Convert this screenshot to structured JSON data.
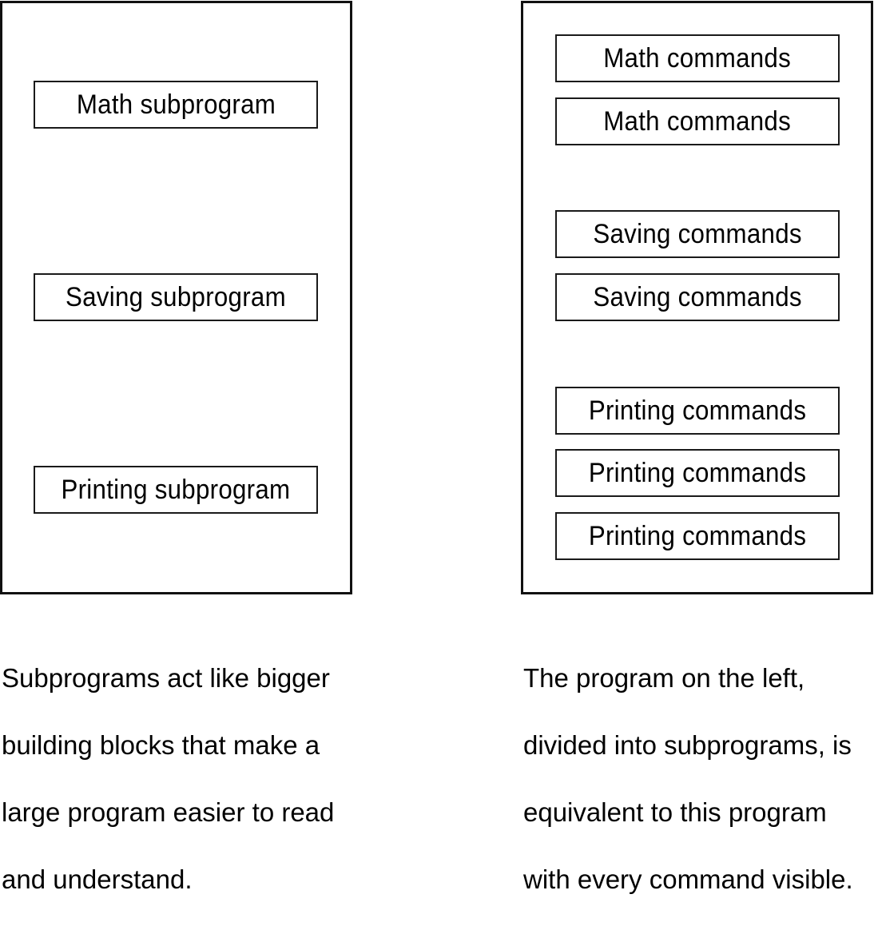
{
  "left_program": {
    "blocks": [
      {
        "label": "Math subprogram"
      },
      {
        "label": "Saving subprogram"
      },
      {
        "label": "Printing subprogram"
      }
    ],
    "caption_lines": [
      "Subprograms act like bigger",
      "building blocks that make a",
      "large program easier to read",
      "and understand."
    ]
  },
  "right_program": {
    "blocks": [
      {
        "label": "Math commands"
      },
      {
        "label": "Math commands"
      },
      {
        "label": "Saving commands"
      },
      {
        "label": "Saving commands"
      },
      {
        "label": "Printing commands"
      },
      {
        "label": "Printing commands"
      },
      {
        "label": "Printing commands"
      }
    ],
    "caption_lines": [
      "The program on the left,",
      "divided into subprograms, is",
      "equivalent to this program",
      "with every command visible."
    ]
  },
  "colors": {
    "border": "#111111",
    "background": "#ffffff",
    "text": "#000000"
  }
}
